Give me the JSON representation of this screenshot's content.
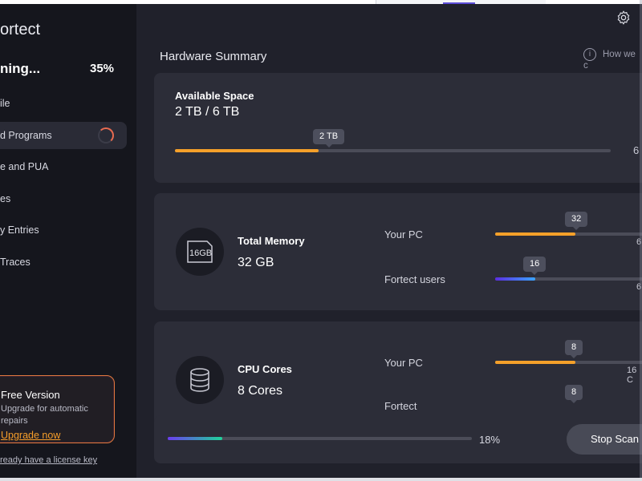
{
  "colors": {
    "accent_orange": "#f5a02a",
    "accent_blue_gradient": [
      "#5b2ee0",
      "#3aa4ff"
    ],
    "scan_gradient": [
      "#6b3df0",
      "#1fd49a"
    ],
    "card_bg": "#2c2d38",
    "sidebar_bg": "#15161d"
  },
  "app": {
    "logo_text": "ortect"
  },
  "scan": {
    "status": "ning...",
    "percent": "35%",
    "progress_label": "18%",
    "progress_fraction": 0.18,
    "stop_label": "Stop Scan"
  },
  "sidebar": {
    "items": [
      {
        "label": "ile"
      },
      {
        "label": "d Programs",
        "active": true
      },
      {
        "label": "e and PUA"
      },
      {
        "label": "es"
      },
      {
        "label": "y Entries"
      },
      {
        "label": "Traces"
      }
    ],
    "free_card": {
      "title": "Free Version",
      "desc": "Upgrade for automatic repairs",
      "link": "Upgrade now"
    },
    "license_link": "ready have a license key"
  },
  "main": {
    "title": "Hardware Summary",
    "help": "How we c",
    "storage": {
      "title": "Available Space",
      "value": "2 TB / 6 TB",
      "bubble": "2 TB",
      "max": "6",
      "fraction": 0.33
    },
    "memory": {
      "title": "Total Memory",
      "value": "32 GB",
      "chip_label": "16GB",
      "rows": [
        {
          "label": "Your PC",
          "bubble": "32",
          "max": "6",
          "fraction": 0.5
        },
        {
          "label": "Fortect users",
          "bubble": "16",
          "max": "6",
          "fraction": 0.25
        }
      ]
    },
    "cpu": {
      "title": "CPU Cores",
      "value": "8 Cores",
      "rows": [
        {
          "label": "Your PC",
          "bubble": "8",
          "max": "16 C",
          "fraction": 0.5
        },
        {
          "label": "Fortect",
          "bubble": "8",
          "max": "",
          "fraction": 0.5
        }
      ]
    }
  },
  "icons": {
    "gear": "gear-icon",
    "info": "info-icon",
    "memory": "memory-card-icon",
    "cpu": "database-stack-icon",
    "spinner": "loading-spinner-icon"
  }
}
